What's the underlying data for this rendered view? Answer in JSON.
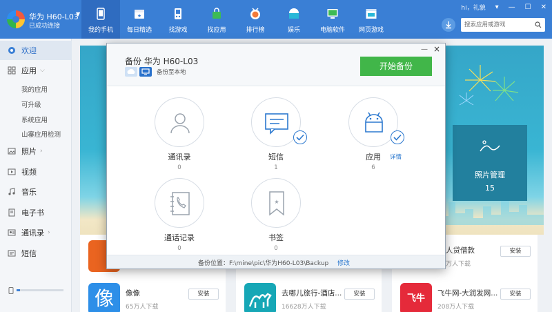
{
  "device": {
    "name": "华为 H60-L03",
    "status": "已成功连接"
  },
  "nav": [
    {
      "label": "我的手机",
      "icon": "phone-icon",
      "active": true
    },
    {
      "label": "每日精选",
      "icon": "calendar-icon"
    },
    {
      "label": "找游戏",
      "icon": "gamepad-icon"
    },
    {
      "label": "找应用",
      "icon": "bag-icon"
    },
    {
      "label": "排行榜",
      "icon": "medal-icon"
    },
    {
      "label": "娱乐",
      "icon": "tv-icon"
    },
    {
      "label": "电脑软件",
      "icon": "monitor-icon"
    },
    {
      "label": "网页游戏",
      "icon": "browser-icon"
    }
  ],
  "header": {
    "user": "hi，礼貌",
    "search_placeholder": "搜索应用或游戏"
  },
  "sidebar": {
    "welcome": "欢迎",
    "apps": "应用",
    "apps_sub": [
      "我的应用",
      "可升级",
      "系统应用",
      "山寨应用检测"
    ],
    "photos": "照片",
    "videos": "视频",
    "music": "音乐",
    "ebooks": "电子书",
    "contacts": "通讯录",
    "sms": "短信",
    "storage_fraction": 0.08
  },
  "banner": {
    "photo_title": "照片管理",
    "photo_count": "15"
  },
  "apps": [
    {
      "name": "",
      "downloads": "",
      "install": "安装",
      "icon_color": "#ea6420"
    },
    {
      "name": "",
      "downloads": "",
      "install": "安装",
      "icon_color": "#ffffff"
    },
    {
      "name": "人贷借款",
      "downloads": "万人下载",
      "install": "安装",
      "icon_color": "#ffffff"
    },
    {
      "name": "像像",
      "downloads": "65万人下载",
      "install": "安装",
      "icon_color": "#2d8fe8"
    },
    {
      "name": "去哪儿旅行-酒店...",
      "downloads": "16628万人下载",
      "install": "安装",
      "icon_color": "#16a7b6"
    },
    {
      "name": "飞牛网-大润发网...",
      "downloads": "208万人下载",
      "install": "安装",
      "icon_color": "#e52a3a"
    }
  ],
  "dialog": {
    "title": "备份 华为 H60-L03",
    "mode_label": "备份至本地",
    "start_button": "开始备份",
    "items": [
      {
        "label": "通讯录",
        "count": "0",
        "checked": false,
        "icon": "contacts-icon"
      },
      {
        "label": "短信",
        "count": "1",
        "checked": true,
        "icon": "sms-icon"
      },
      {
        "label": "应用",
        "count": "6",
        "checked": true,
        "icon": "android-icon",
        "detail": "详情"
      },
      {
        "label": "通话记录",
        "count": "0",
        "checked": false,
        "icon": "call-log-icon"
      },
      {
        "label": "书签",
        "count": "0",
        "checked": false,
        "icon": "bookmark-icon"
      }
    ],
    "footer_path": "备份位置：F:\\mine\\pic\\华为H60-L03\\Backup",
    "footer_modify": "修改"
  },
  "colors": {
    "topbar": "#3a7fd5",
    "start_button": "#41b649",
    "accent": "#2b78cf"
  }
}
